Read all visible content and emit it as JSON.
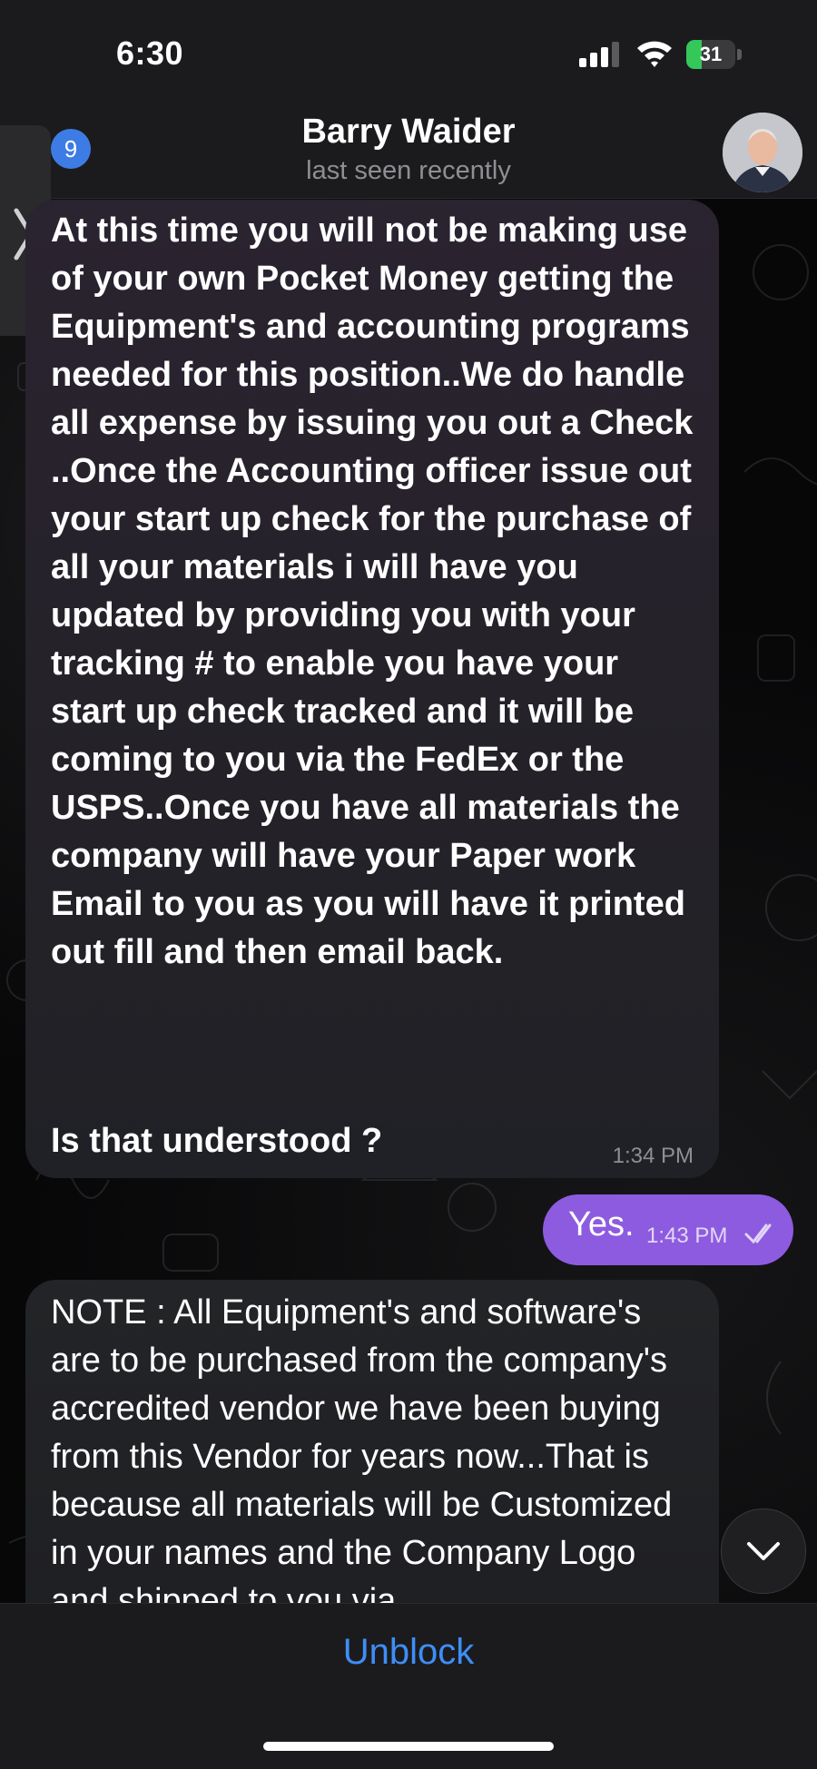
{
  "status_bar": {
    "time": "6:30",
    "battery": "31",
    "battery_level": 0.31,
    "icons": [
      "signal-icon",
      "wifi-icon",
      "battery-charging-icon"
    ]
  },
  "header": {
    "back_badge_count": "9",
    "contact_name": "Barry Waider",
    "contact_status": "last seen recently"
  },
  "messages": [
    {
      "direction": "incoming",
      "text": "At this time you will not be making use of your own Pocket Money getting the Equipment's and accounting programs needed for this position..We do handle all expense by issuing you out a Check ..Once the Accounting officer issue out your start up check for the purchase of all your materials i will have you updated by providing you with your tracking # to enable you have your start up check tracked and it will be coming to you via the FedEx or the USPS..Once you have all materials the company will have your Paper work Email to you as you will have it printed out fill and then email back.",
      "question": "Is that understood ?",
      "time": "1:34 PM"
    },
    {
      "direction": "outgoing",
      "text": "Yes.",
      "time": "1:43 PM",
      "status": "read"
    },
    {
      "direction": "incoming",
      "text": "NOTE :  All Equipment's and software's are to be purchased from the company's accredited vendor we have been buying from this Vendor for years now...That is because all materials will be Customized in your names and the Company Logo and shipped to you via"
    }
  ],
  "footer": {
    "unblock_label": "Unblock"
  },
  "colors": {
    "outgoing_bubble": "#8d5be0",
    "link_blue": "#3e8ef7",
    "badge_blue": "#3d7ce4"
  }
}
